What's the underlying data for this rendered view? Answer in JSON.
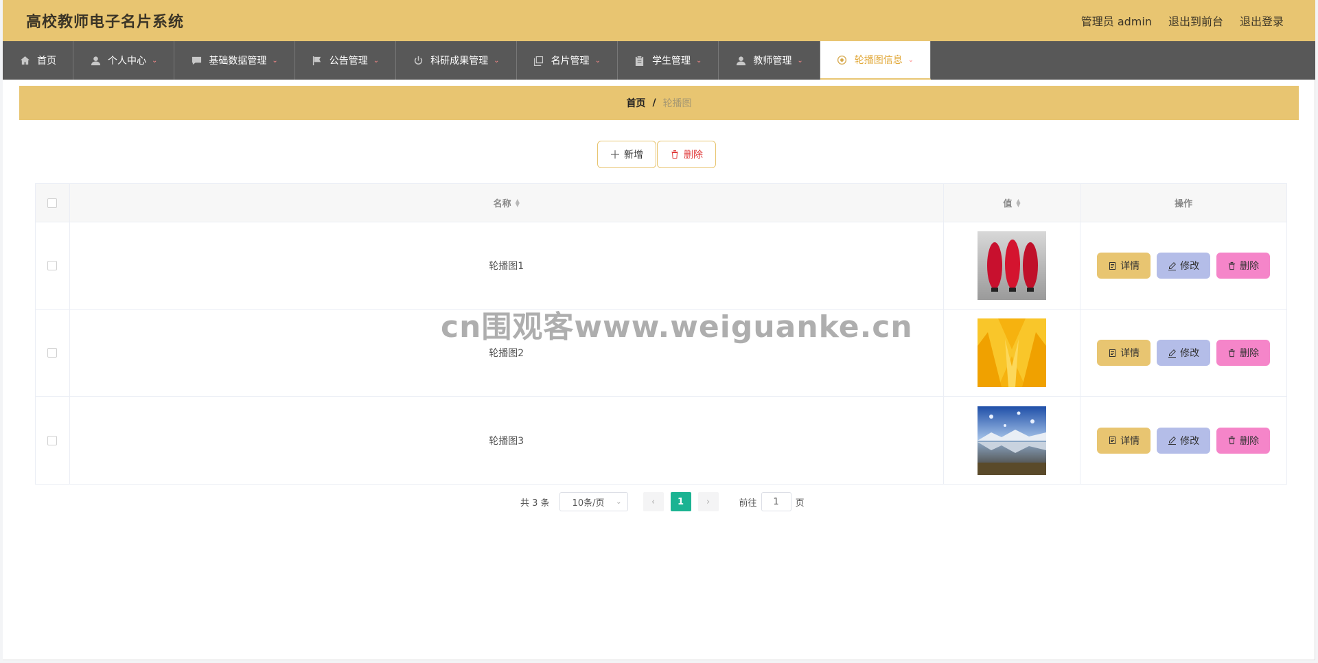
{
  "header": {
    "title": "高校教师电子名片系统",
    "admin_label": "管理员 admin",
    "to_front": "退出到前台",
    "logout": "退出登录"
  },
  "nav": [
    {
      "label": "首页",
      "icon": "home-icon",
      "caret": false
    },
    {
      "label": "个人中心",
      "icon": "user-icon",
      "caret": true
    },
    {
      "label": "基础数据管理",
      "icon": "message-icon",
      "caret": true
    },
    {
      "label": "公告管理",
      "icon": "flag-icon",
      "caret": true
    },
    {
      "label": "科研成果管理",
      "icon": "power-icon",
      "caret": true
    },
    {
      "label": "名片管理",
      "icon": "copy-icon",
      "caret": true
    },
    {
      "label": "学生管理",
      "icon": "clipboard-icon",
      "caret": true
    },
    {
      "label": "教师管理",
      "icon": "user-icon",
      "caret": true
    },
    {
      "label": "轮播图信息",
      "icon": "aperture-icon",
      "caret": true,
      "active": true
    }
  ],
  "breadcrumb": {
    "home": "首页",
    "sep": "/",
    "current": "轮播图"
  },
  "toolbar": {
    "add_label": "新增",
    "delete_label": "删除"
  },
  "table": {
    "columns": {
      "name": "名称",
      "value": "值",
      "ops": "操作"
    },
    "rows": [
      {
        "name": "轮播图1",
        "image": "red-cones-image"
      },
      {
        "name": "轮播图2",
        "image": "yellow-pattern-image"
      },
      {
        "name": "轮播图3",
        "image": "mountain-lake-image"
      }
    ],
    "op_labels": {
      "detail": "详情",
      "edit": "修改",
      "delete": "删除"
    }
  },
  "pagination": {
    "total": "共 3 条",
    "page_size": "10条/页",
    "current_page": "1",
    "goto_prefix": "前往",
    "goto_value": "1",
    "goto_suffix": "页"
  },
  "watermark": "cn围观客www.weiguanke.cn",
  "colors": {
    "accent": "#e8c571",
    "nav_bg": "#585858",
    "detail": "#e8c571",
    "edit": "#b4bde8",
    "delete": "#f585c9",
    "page_active": "#1bb392"
  }
}
